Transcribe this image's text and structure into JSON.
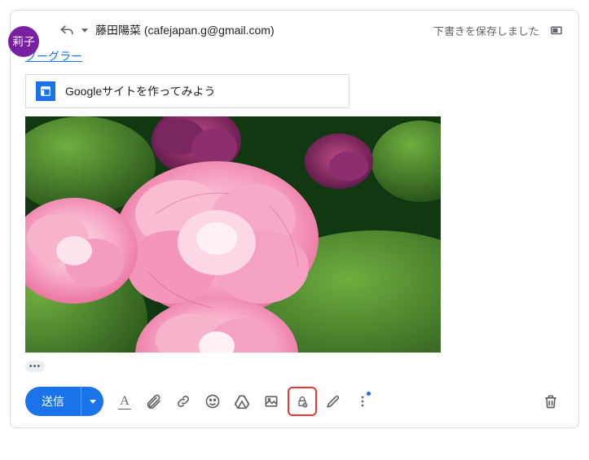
{
  "avatar": {
    "initials": "莉子"
  },
  "header": {
    "recipient": "藤田陽菜 (cafejapan.g@gmail.com)",
    "status": "下書きを保存しました"
  },
  "body": {
    "link_text": "グーグラー",
    "drive_chip": {
      "title": "Googleサイトを作ってみよう"
    }
  },
  "toolbar": {
    "send_label": "送信",
    "trimmed_label": "•••"
  },
  "icons": {
    "reply": "reply",
    "recipients_more": "caret-down",
    "popout": "popout",
    "format": "A",
    "attach": "attach",
    "link": "link",
    "emoji": "emoji",
    "drive": "drive",
    "image": "image",
    "lock": "lock",
    "sign": "sign",
    "more": "more",
    "trash": "trash"
  }
}
